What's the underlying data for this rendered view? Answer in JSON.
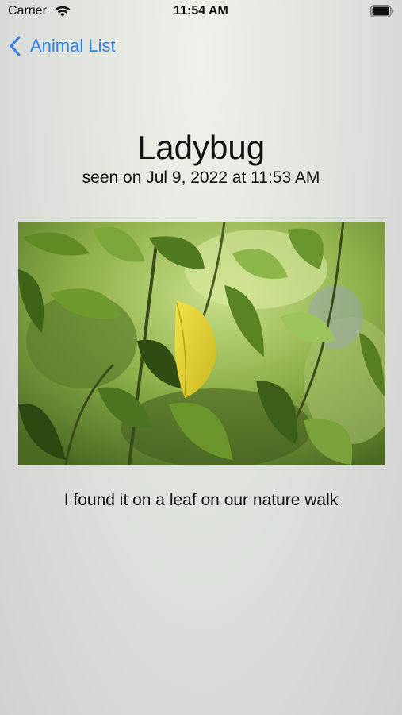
{
  "status_bar": {
    "carrier": "Carrier",
    "time": "11:54 AM",
    "wifi_icon": "wifi-icon",
    "battery_icon": "battery-icon"
  },
  "nav": {
    "back_label": "Animal List",
    "back_icon": "chevron-left-icon",
    "accent_color": "#2f7fe0"
  },
  "detail": {
    "title": "Ladybug",
    "seen_text": "seen on Jul 9, 2022 at 11:53 AM",
    "description": "I found it on a leaf on our nature walk"
  }
}
